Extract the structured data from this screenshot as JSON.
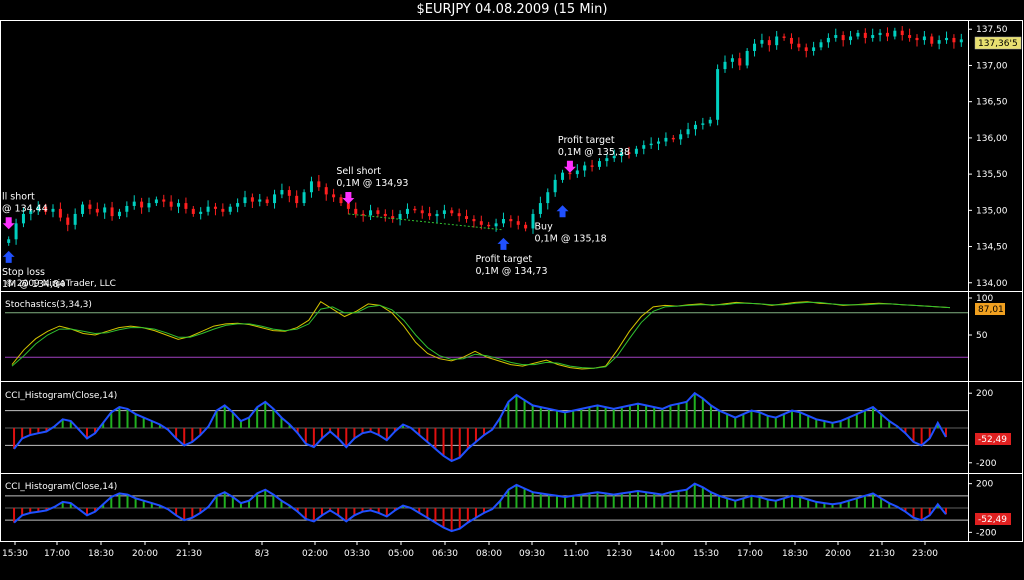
{
  "window": {
    "title": "$EURJPY  04.08.2009 (15 Min)"
  },
  "copyright": "© 2009 NinjaTrader, LLC",
  "colors": {
    "up": "#00d0c0",
    "down": "#ff2020",
    "stoch_k": "#d4c400",
    "stoch_d": "#30c030",
    "cci_pos": "#20b020",
    "cci_neg": "#e01010",
    "cci_line": "#2050ff",
    "arrow_buy": "#2050ff",
    "arrow_sell": "#ff30ff"
  },
  "chart_data": [
    {
      "type": "candlestick",
      "panel": "price",
      "ylim": [
        133.9,
        137.6
      ],
      "y_ticks": [
        134.0,
        134.5,
        135.0,
        135.5,
        136.0,
        136.5,
        137.0,
        137.5
      ],
      "y_tick_labels": [
        "134,00",
        "134,50",
        "135,00",
        "135,50",
        "136,00",
        "136,50",
        "137,00",
        "137,50"
      ],
      "last_price_label": "137,36'5",
      "x_ticks": [
        "15:30",
        "17:00",
        "18:30",
        "20:00",
        "21:30",
        "8/3",
        "02:00",
        "03:30",
        "05:00",
        "06:30",
        "08:00",
        "09:30",
        "11:00",
        "12:30",
        "14:00",
        "15:30",
        "17:00",
        "18:30",
        "20:00",
        "21:30",
        "23:00"
      ],
      "close_values": [
        134.6,
        134.82,
        134.95,
        135.0,
        135.05,
        134.98,
        135.02,
        134.9,
        134.8,
        134.95,
        135.08,
        135.02,
        134.97,
        135.04,
        134.92,
        134.98,
        135.06,
        135.12,
        135.04,
        135.1,
        135.15,
        135.12,
        135.05,
        135.1,
        135.02,
        134.95,
        134.98,
        135.05,
        135.02,
        134.98,
        135.05,
        135.1,
        135.18,
        135.12,
        135.15,
        135.1,
        135.22,
        135.28,
        135.2,
        135.1,
        135.25,
        135.4,
        135.32,
        135.22,
        135.18,
        135.1,
        135.02,
        134.95,
        134.93,
        135.0,
        134.95,
        134.92,
        134.88,
        134.95,
        135.02,
        135.0,
        134.96,
        134.92,
        134.95,
        135.0,
        134.96,
        134.92,
        134.88,
        134.85,
        134.8,
        134.78,
        134.82,
        134.88,
        134.85,
        134.8,
        134.75,
        134.95,
        135.1,
        135.25,
        135.42,
        135.52,
        135.5,
        135.55,
        135.62,
        135.6,
        135.68,
        135.72,
        135.75,
        135.8,
        135.78,
        135.85,
        135.9,
        135.92,
        135.95,
        136.0,
        135.98,
        136.05,
        136.12,
        136.18,
        136.2,
        136.25,
        136.95,
        137.05,
        137.1,
        137.0,
        137.2,
        137.3,
        137.35,
        137.28,
        137.4,
        137.38,
        137.3,
        137.25,
        137.2,
        137.25,
        137.32,
        137.38,
        137.42,
        137.35,
        137.4,
        137.45,
        137.38,
        137.42,
        137.45,
        137.4,
        137.48,
        137.42,
        137.38,
        137.35,
        137.4,
        137.3,
        137.35,
        137.38,
        137.32,
        137.36
      ],
      "annotations": [
        {
          "lines": [
            "ll short",
            "@ 134,44"
          ],
          "x_index": 0,
          "price": 134.6,
          "side": "above"
        },
        {
          "lines": [
            "Stop loss",
            "1M @ 134,84"
          ],
          "x_index": 0,
          "price": 134.55,
          "side": "below"
        },
        {
          "lines": [
            "Sell short",
            "0,1M @ 134,93"
          ],
          "x_index": 46,
          "price": 134.95,
          "side": "above"
        },
        {
          "lines": [
            "Profit target",
            "0,1M @ 134,73"
          ],
          "x_index": 67,
          "price": 134.73,
          "side": "below"
        },
        {
          "lines": [
            "Profit target",
            "0,1M @ 135,38"
          ],
          "x_index": 76,
          "price": 135.38,
          "side": "above"
        },
        {
          "lines": [
            "Buy",
            "0,1M @ 135,18"
          ],
          "x_index": 75,
          "price": 135.18,
          "side": "below"
        }
      ]
    },
    {
      "type": "line",
      "panel": "stochastics",
      "title": "Stochastics(3,34,3)",
      "ylim": [
        0,
        100
      ],
      "y_ticks": [
        50,
        100
      ],
      "y_tick_labels": [
        "50",
        "100"
      ],
      "last_value_label": "87,01",
      "levels": [
        20,
        80
      ],
      "series": [
        {
          "name": "K",
          "values": [
            10,
            30,
            45,
            55,
            62,
            58,
            52,
            50,
            55,
            60,
            62,
            60,
            56,
            50,
            44,
            48,
            55,
            62,
            65,
            66,
            64,
            60,
            56,
            55,
            60,
            70,
            95,
            85,
            75,
            82,
            92,
            90,
            80,
            62,
            40,
            25,
            18,
            15,
            20,
            28,
            20,
            15,
            10,
            8,
            12,
            16,
            10,
            6,
            4,
            5,
            8,
            30,
            55,
            75,
            88,
            90,
            89,
            91,
            92,
            90,
            92,
            94,
            93,
            92,
            90,
            92,
            94,
            95,
            93,
            92,
            90,
            91,
            92,
            93,
            92,
            91,
            90,
            89,
            88,
            87
          ]
        },
        {
          "name": "D",
          "values": [
            8,
            22,
            38,
            50,
            58,
            58,
            55,
            52,
            53,
            57,
            60,
            60,
            58,
            53,
            47,
            47,
            52,
            58,
            63,
            65,
            65,
            62,
            58,
            56,
            58,
            65,
            85,
            88,
            80,
            80,
            88,
            90,
            84,
            70,
            50,
            33,
            22,
            17,
            18,
            24,
            22,
            18,
            13,
            10,
            10,
            13,
            12,
            8,
            6,
            5,
            7,
            22,
            45,
            67,
            82,
            88,
            89,
            90,
            91,
            91,
            91,
            93,
            93,
            92,
            91,
            91,
            93,
            94,
            94,
            92,
            91,
            91,
            91,
            92,
            92,
            91,
            90,
            89,
            88,
            87
          ]
        }
      ]
    },
    {
      "type": "bar",
      "panel": "cci1",
      "title": "CCI_Histogram(Close,14)",
      "ylim": [
        -230,
        230
      ],
      "y_ticks": [
        -200,
        200
      ],
      "y_tick_labels": [
        "-200",
        "200"
      ],
      "last_value_label": "-52,49",
      "levels": [
        -100,
        0,
        100
      ],
      "values": [
        -120,
        -60,
        -40,
        -30,
        -20,
        10,
        50,
        40,
        -10,
        -60,
        -30,
        30,
        90,
        120,
        110,
        80,
        60,
        40,
        20,
        -10,
        -60,
        -100,
        -80,
        -40,
        10,
        100,
        130,
        90,
        40,
        60,
        120,
        150,
        110,
        60,
        20,
        -30,
        -90,
        -110,
        -60,
        -20,
        -60,
        -110,
        -60,
        -30,
        -20,
        -40,
        -70,
        -20,
        20,
        0,
        -40,
        -80,
        -120,
        -160,
        -190,
        -170,
        -120,
        -80,
        -40,
        -10,
        60,
        150,
        190,
        160,
        130,
        120,
        110,
        100,
        90,
        100,
        110,
        120,
        130,
        120,
        110,
        120,
        130,
        140,
        130,
        120,
        110,
        130,
        140,
        150,
        200,
        170,
        130,
        100,
        80,
        60,
        80,
        100,
        90,
        70,
        60,
        80,
        100,
        90,
        70,
        50,
        40,
        30,
        40,
        60,
        80,
        100,
        120,
        80,
        40,
        10,
        -30,
        -80,
        -100,
        -60,
        30,
        -52
      ]
    },
    {
      "type": "bar",
      "panel": "cci2",
      "title": "CCI_Histogram(Close,14)",
      "ylim": [
        -230,
        230
      ],
      "y_ticks": [
        -200,
        200
      ],
      "y_tick_labels": [
        "-200",
        "200"
      ],
      "last_value_label": "-52,49",
      "levels": [
        -100,
        0,
        100
      ],
      "values": [
        -120,
        -60,
        -40,
        -30,
        -20,
        10,
        50,
        40,
        -10,
        -60,
        -30,
        30,
        90,
        120,
        110,
        80,
        60,
        40,
        20,
        -10,
        -60,
        -100,
        -80,
        -40,
        10,
        100,
        130,
        90,
        40,
        60,
        120,
        150,
        110,
        60,
        20,
        -30,
        -90,
        -110,
        -60,
        -20,
        -60,
        -110,
        -60,
        -30,
        -20,
        -40,
        -70,
        -20,
        20,
        0,
        -40,
        -80,
        -120,
        -160,
        -190,
        -170,
        -120,
        -80,
        -40,
        -10,
        60,
        150,
        190,
        160,
        130,
        120,
        110,
        100,
        90,
        100,
        110,
        120,
        130,
        120,
        110,
        120,
        130,
        140,
        130,
        120,
        110,
        130,
        140,
        150,
        200,
        170,
        130,
        100,
        80,
        60,
        80,
        100,
        90,
        70,
        60,
        80,
        100,
        90,
        70,
        50,
        40,
        30,
        40,
        60,
        80,
        100,
        120,
        80,
        40,
        10,
        -30,
        -80,
        -100,
        -60,
        30,
        -52
      ]
    }
  ]
}
